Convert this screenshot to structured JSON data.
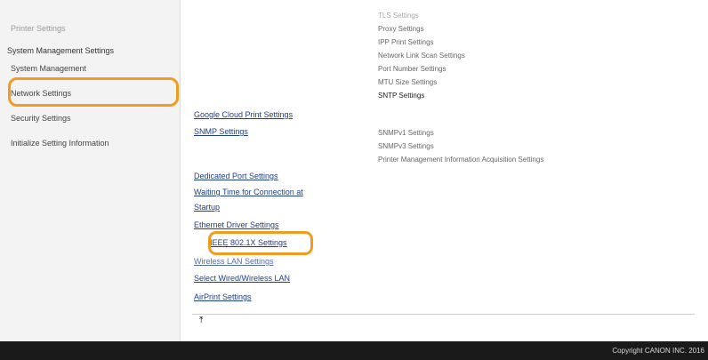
{
  "sidebar": {
    "printer_settings": "Printer Settings",
    "system_management_settings": "System Management Settings",
    "system_management": "System Management",
    "network_settings": "Network Settings",
    "security_settings": "Security Settings",
    "initialize_setting_information": "Initialize Setting Information"
  },
  "right_links": {
    "tls": "TLS Settings",
    "proxy": "Proxy Settings",
    "ipp_print": "IPP Print Settings",
    "network_link_scan": "Network Link Scan Settings",
    "port_number": "Port Number Settings",
    "mtu_size": "MTU Size Settings",
    "sntp": "SNTP Settings",
    "snmpv1": "SNMPv1 Settings",
    "snmpv3": "SNMPv3 Settings",
    "printer_mgmt_info": "Printer Management Information Acquisition Settings"
  },
  "center_links": {
    "google_cloud_print": "Google Cloud Print Settings",
    "snmp": "SNMP Settings",
    "dedicated_port": "Dedicated Port Settings",
    "waiting_time_line1": "Waiting Time for Connection at",
    "waiting_time_line2": "Startup",
    "ethernet_driver": "Ethernet Driver Settings",
    "ieee_8021x": "IEEE 802.1X Settings",
    "wireless_lan": "Wireless LAN Settings",
    "select_wired_wireless": "Select Wired/Wireless LAN",
    "airprint": "AirPrint Settings"
  },
  "icons": {
    "back_to_top": "back-to-top-icon"
  },
  "footer": {
    "copyright": "Copyright CANON INC. 2016"
  },
  "colors": {
    "highlight": "#f39b1f",
    "link": "#1f3f87",
    "footer_bg": "#1a1a1a"
  }
}
